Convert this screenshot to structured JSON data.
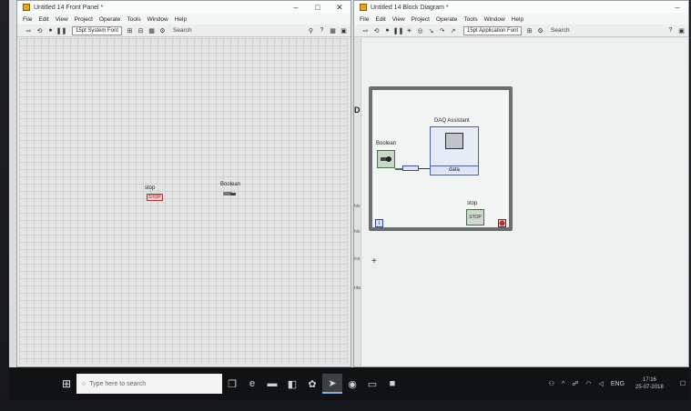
{
  "front_panel": {
    "title": "Untitled 14 Front Panel *",
    "menu": [
      "File",
      "Edit",
      "View",
      "Project",
      "Operate",
      "Tools",
      "Window",
      "Help"
    ],
    "font": "15pt System Font",
    "search_label": "Search",
    "controls": {
      "stop_label": "stop",
      "stop_button_text": "STOP",
      "boolean_label": "Boolean"
    }
  },
  "block_diagram": {
    "title": "Untitled 14 Block Diagram *",
    "menu": [
      "File",
      "Edit",
      "View",
      "Project",
      "Operate",
      "Tools",
      "Window",
      "Help"
    ],
    "font": "15pt Application Font",
    "search_label": "Search",
    "palette_letter": "D",
    "strip_labels": [
      "his",
      "his",
      "ice",
      "nta"
    ],
    "nodes": {
      "boolean_label": "Boolean",
      "daq_label": "DAQ Assistant",
      "daq_output": "data",
      "stop_label": "stop",
      "stop_term_text": "STOP",
      "iteration_symbol": "i"
    }
  },
  "taskbar": {
    "search_placeholder": "Type here to search",
    "language": "ENG",
    "time": "17:16",
    "date": "25-07-2018"
  }
}
